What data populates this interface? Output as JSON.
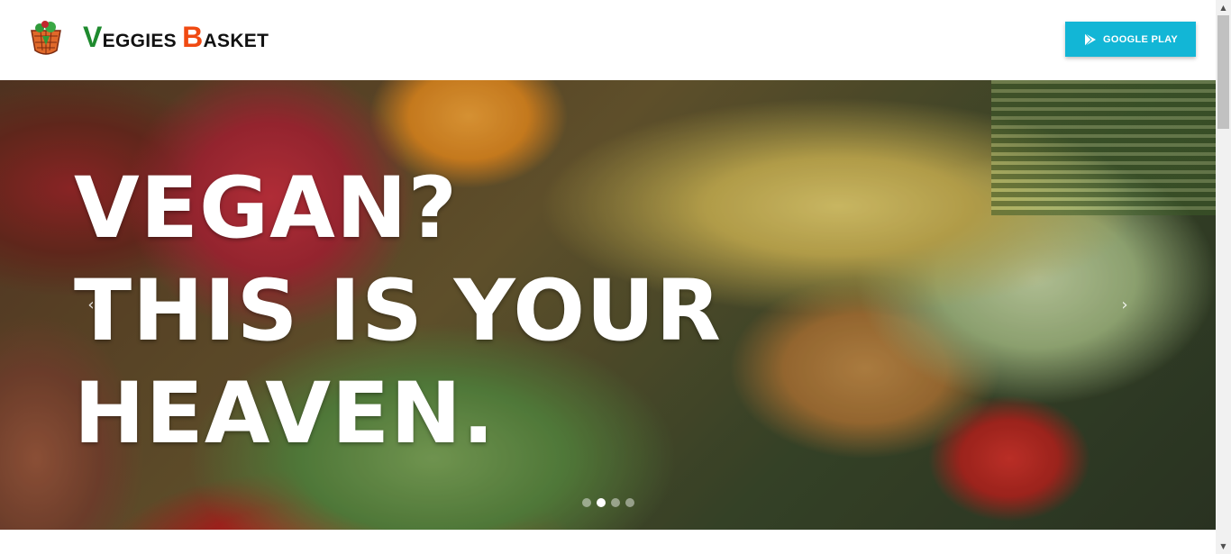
{
  "header": {
    "brand": {
      "first_initial": "V",
      "first_rest": "EGGIES",
      "second_initial": "B",
      "second_rest": "ASKET"
    },
    "google_play_label": "GOOGLE PLAY",
    "logo_icon": "veggie-basket-logo-icon",
    "play_icon": "play-store-icon"
  },
  "hero": {
    "title_lines": [
      "VEGAN?",
      "THIS IS YOUR",
      "HEAVEN."
    ],
    "prev_arrow": "‹",
    "next_arrow": "›",
    "slide_count": 4,
    "active_slide": 2
  },
  "colors": {
    "brand_green": "#1e8a2e",
    "brand_orange": "#f04a12",
    "button_cyan": "#12b6d6"
  }
}
